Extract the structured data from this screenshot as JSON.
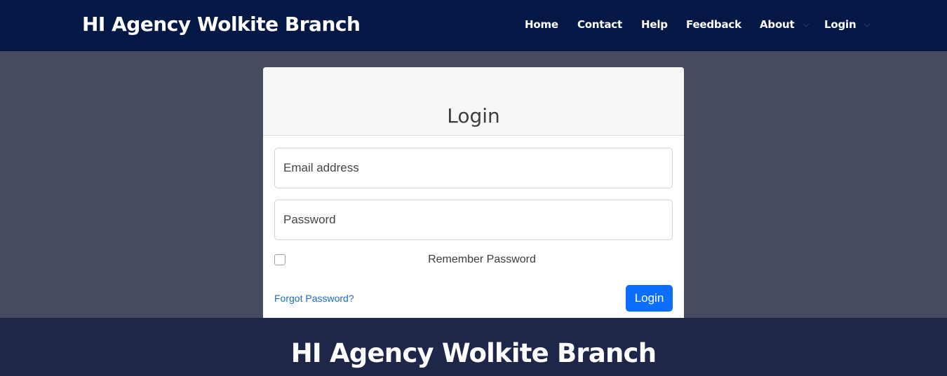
{
  "navbar": {
    "brand": "HI Agency Wolkite Branch",
    "items": [
      {
        "label": "Home"
      },
      {
        "label": "Contact"
      },
      {
        "label": "Help"
      },
      {
        "label": "Feedback"
      },
      {
        "label": "About",
        "icon": "chevron-down-icon"
      },
      {
        "label": "Login",
        "icon": "chevron-down-icon"
      }
    ]
  },
  "login_card": {
    "title": "Login",
    "email_placeholder": "Email address",
    "password_placeholder": "Password",
    "remember_label": "Remember Password",
    "remember_checked": false,
    "forgot_label": "Forgot Password?",
    "submit_label": "Login"
  },
  "footer": {
    "title": "HI Agency Wolkite Branch"
  },
  "colors": {
    "navbar_bg": "#041845",
    "page_bg": "#464b5f",
    "footer_bg": "#1e2649",
    "primary_button": "#0d6efd",
    "link": "#1f6cb8"
  }
}
